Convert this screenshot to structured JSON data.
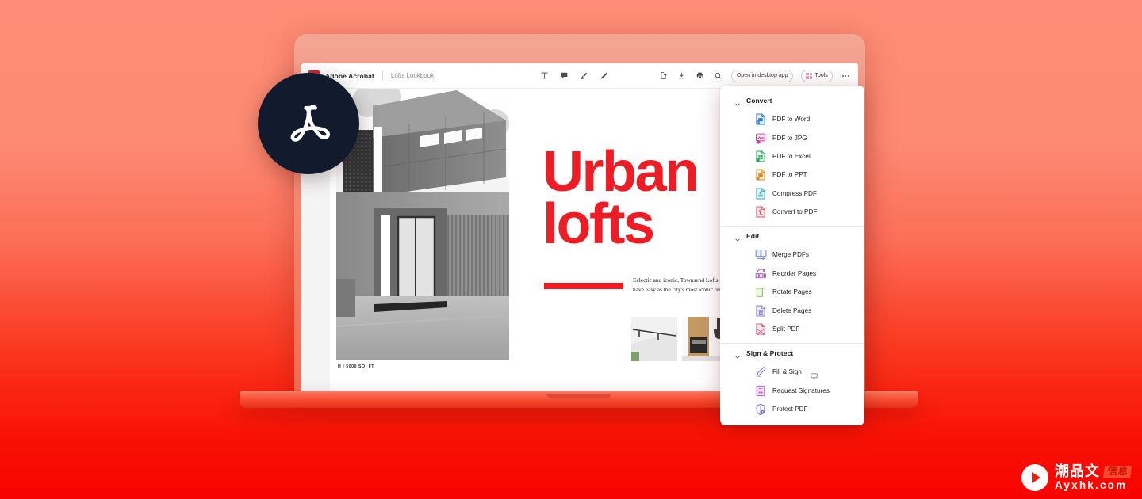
{
  "background": {
    "gradient_top": "#fd8d76",
    "gradient_bottom": "#f70300"
  },
  "app": {
    "brand_name": "Adobe Acrobat",
    "document_name": "Lofts Lookbook",
    "accent_red": "#d8232a",
    "logo_circle_bg": "#121a2d",
    "toolbar": {
      "annotation_tools": [
        {
          "name": "add-text-icon",
          "label": "Add text"
        },
        {
          "name": "add-comment-icon",
          "label": "Add comment"
        },
        {
          "name": "highlighter-icon",
          "label": "Highlight"
        },
        {
          "name": "draw-icon",
          "label": "Draw"
        }
      ],
      "actions": [
        {
          "name": "share-icon",
          "label": "Share"
        },
        {
          "name": "download-icon",
          "label": "Download"
        },
        {
          "name": "print-icon",
          "label": "Print"
        },
        {
          "name": "search-icon",
          "label": "Search"
        }
      ],
      "open_desktop_label": "Open in desktop app",
      "tools_label": "Tools",
      "more_label": "More options"
    }
  },
  "document": {
    "headline_line1": "Urban",
    "headline_line2": "lofts",
    "headline_color": "#ee1d25",
    "body_copy": "Eclectic and iconic, Townsend Lofts is a bold located at the heart of the city, you have easy as the city's most iconic restaurants and nightl",
    "photo_caption": "H | 5000 SQ. FT"
  },
  "tools_menu": {
    "groups": [
      {
        "title": "Convert",
        "items": [
          {
            "label": "PDF to Word",
            "icon": "pdf-to-word-icon",
            "color": "#2e7ccc",
            "tint": "#e3effb"
          },
          {
            "label": "PDF to JPG",
            "icon": "pdf-to-jpg-icon",
            "color": "#d6369a",
            "tint": "#fbe4f3"
          },
          {
            "label": "PDF to Excel",
            "icon": "pdf-to-excel-icon",
            "color": "#2f9e5e",
            "tint": "#e2f5e9"
          },
          {
            "label": "PDF to PPT",
            "icon": "pdf-to-ppt-icon",
            "color": "#e08b1e",
            "tint": "#fdf0dc"
          },
          {
            "label": "Compress PDF",
            "icon": "compress-pdf-icon",
            "color": "#36a9b8",
            "tint": "#e1f5f7"
          },
          {
            "label": "Convert to PDF",
            "icon": "convert-to-pdf-icon",
            "color": "#e0555f",
            "tint": "#fce6e8"
          }
        ]
      },
      {
        "title": "Edit",
        "items": [
          {
            "label": "Merge PDFs",
            "icon": "merge-pdfs-icon",
            "color": "#6f7fd4",
            "tint": "#e8ebfa"
          },
          {
            "label": "Reorder Pages",
            "icon": "reorder-pages-icon",
            "color": "#a855b8",
            "tint": "#f5e6f8"
          },
          {
            "label": "Rotate Pages",
            "icon": "rotate-pages-icon",
            "color": "#86b84e",
            "tint": "#eef6e3"
          },
          {
            "label": "Delete Pages",
            "icon": "delete-pages-icon",
            "color": "#8e7fd0",
            "tint": "#ece9f8"
          },
          {
            "label": "Split PDF",
            "icon": "split-pdf-icon",
            "color": "#d45f86",
            "tint": "#fbe7ef"
          }
        ]
      },
      {
        "title": "Sign & Protect",
        "items": [
          {
            "label": "Fill & Sign",
            "icon": "fill-and-sign-icon",
            "color": "#8e6fd0",
            "tint": "#ffffff",
            "aux_icon": "desktop-icon"
          },
          {
            "label": "Request Signatures",
            "icon": "request-signatures-icon",
            "color": "#b35fd0",
            "tint": "#f7e9fb"
          },
          {
            "label": "Protect PDF",
            "icon": "protect-pdf-icon",
            "color": "#7f6fc9",
            "tint": "#ffffff"
          }
        ]
      }
    ]
  },
  "watermark": {
    "cn_text": "潮品文",
    "stamp_text": "信息",
    "url_text": "Ayxhk.com",
    "play_icon": "play-circle-icon"
  }
}
